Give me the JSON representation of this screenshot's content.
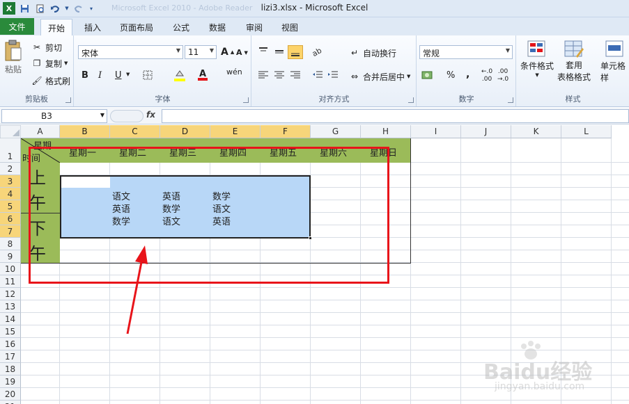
{
  "window": {
    "title": "lizi3.xlsx  -  Microsoft Excel",
    "ghost_title": "Microsoft Excel 2010 - Adobe Reader"
  },
  "quick_access": [
    "save-icon",
    "print-preview-icon",
    "undo-icon",
    "redo-icon",
    "customize-icon"
  ],
  "ribbon_tabs": [
    "文件",
    "开始",
    "插入",
    "页面布局",
    "公式",
    "数据",
    "审阅",
    "视图"
  ],
  "ribbon": {
    "clipboard": {
      "paste": "粘贴",
      "cut": "剪切",
      "copy": "复制",
      "format_painter": "格式刷",
      "label": "剪贴板"
    },
    "font": {
      "name": "宋体",
      "size": "11",
      "bold": "B",
      "italic": "I",
      "underline": "U",
      "label": "字体"
    },
    "alignment": {
      "wrap": "自动换行",
      "merge": "合并后居中",
      "label": "对齐方式"
    },
    "number": {
      "format": "常规",
      "percent": "%",
      "comma": ",",
      "label": "数字"
    },
    "styles": {
      "conditional": "条件格式",
      "table_line1": "套用",
      "table_line2": "表格格式",
      "cell_styles": "单元格样",
      "label": "样式"
    }
  },
  "formula_bar": {
    "name_box": "B3",
    "fx": "fx",
    "formula": ""
  },
  "columns": [
    "A",
    "B",
    "C",
    "D",
    "E",
    "F",
    "G",
    "H",
    "I",
    "J",
    "K",
    "L"
  ],
  "rows": [
    "1",
    "2",
    "3",
    "4",
    "5",
    "6",
    "7",
    "8",
    "9",
    "10",
    "11",
    "12",
    "13",
    "14",
    "15",
    "16",
    "17",
    "18",
    "19",
    "20",
    "21"
  ],
  "sheet": {
    "corner_top": "星期",
    "corner_bottom": "时间",
    "weekdays": [
      "星期一",
      "星期二",
      "星期三",
      "星期四",
      "星期五",
      "星期六",
      "星期日"
    ],
    "morning": [
      "上",
      "午"
    ],
    "afternoon": [
      "下",
      "午"
    ],
    "schedule": [
      [
        "语文",
        "英语",
        "数学"
      ],
      [
        "英语",
        "数学",
        "语文"
      ],
      [
        "数学",
        "语文",
        "英语"
      ]
    ]
  },
  "colors": {
    "header_green": "#9bbb59",
    "selection_blue": "#b8d7f7",
    "annotation_red": "#e8141a",
    "file_tab_green": "#2a8a3b",
    "selected_header": "#f7d57a"
  },
  "watermark": {
    "brand": "Baidu经验",
    "url": "jingyan.baidu.com"
  }
}
